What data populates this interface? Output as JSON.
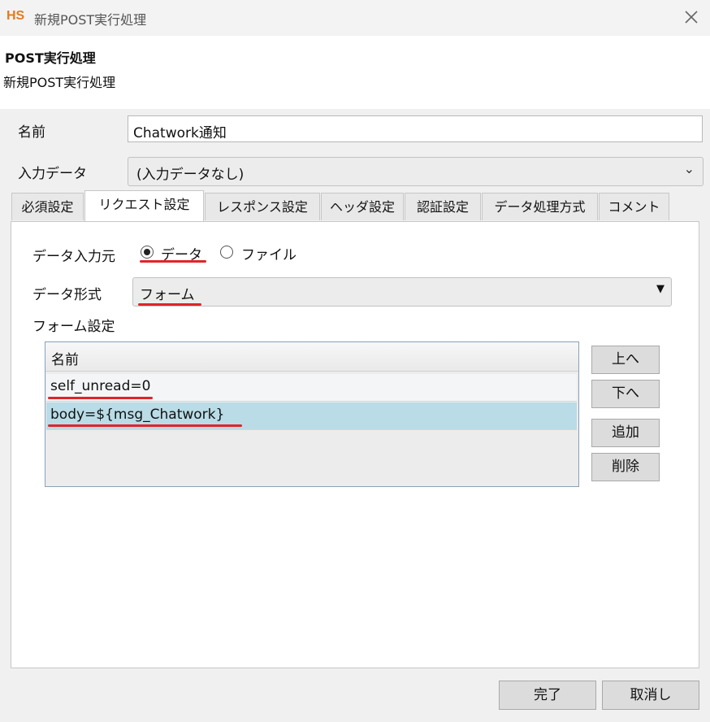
{
  "window": {
    "logo": "HS",
    "title": "新規POST実行処理"
  },
  "header": {
    "title": "POST実行処理",
    "subtitle": "新規POST実行処理"
  },
  "form": {
    "name_label": "名前",
    "name_value": "Chatwork通知",
    "input_label": "入力データ",
    "input_value": "(入力データなし)"
  },
  "tabs": [
    {
      "label": "必須設定"
    },
    {
      "label": "リクエスト設定",
      "active": true
    },
    {
      "label": "レスポンス設定"
    },
    {
      "label": "ヘッダ設定"
    },
    {
      "label": "認証設定"
    },
    {
      "label": "データ処理方式"
    },
    {
      "label": "コメント"
    }
  ],
  "request": {
    "source_label": "データ入力元",
    "source_options": [
      {
        "label": "データ",
        "checked": true
      },
      {
        "label": "ファイル",
        "checked": false
      }
    ],
    "format_label": "データ形式",
    "format_value": "フォーム",
    "form_settings_label": "フォーム設定",
    "list_header": "名前",
    "rows": [
      {
        "text": "self_unread=0"
      },
      {
        "text": "body=${msg_Chatwork}",
        "selected": true
      }
    ],
    "buttons": {
      "up": "上へ",
      "down": "下へ",
      "add": "追加",
      "delete": "削除"
    }
  },
  "footer": {
    "done": "完了",
    "cancel": "取消し"
  },
  "colors": {
    "accent_underline": "#e0242a",
    "selected_row": "#b9dce7",
    "logo": "#e67a1a"
  }
}
